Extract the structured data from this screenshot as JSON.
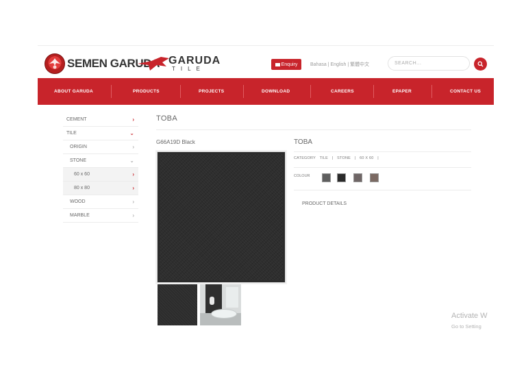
{
  "header": {
    "brand_name": "SEMEN GARUDA",
    "garuda_word": "GARUDA",
    "tile_word": "TILE",
    "enquiry_label": "Enquiry",
    "languages": "Bahasa | English | 繁體中文",
    "search_placeholder": "SEARCH..."
  },
  "nav": {
    "items": [
      "ABOUT GARUDA",
      "PRODUCTS",
      "PROJECTS",
      "DOWNLOAD",
      "CAREERS",
      "EPAPER",
      "CONTACT US"
    ]
  },
  "sidebar": {
    "items": [
      {
        "label": "CEMENT",
        "chevron": "›"
      },
      {
        "label": "TILE",
        "chevron": "⌄"
      },
      {
        "label": "ORIGIN",
        "chevron": "›"
      },
      {
        "label": "STONE",
        "chevron": "⌄"
      },
      {
        "label": "60 x 60",
        "chevron": "›"
      },
      {
        "label": "80 x 80",
        "chevron": "›"
      },
      {
        "label": "WOOD",
        "chevron": "›"
      },
      {
        "label": "MARBLE",
        "chevron": "›"
      }
    ]
  },
  "main": {
    "title": "TOBA",
    "product_code": "G66A19D Black"
  },
  "detail": {
    "name": "TOBA",
    "category_label": "CATEGORY",
    "categories": [
      "TILE",
      "|",
      "STONE",
      "|",
      "60 X 60",
      "|"
    ],
    "colour_label": "COLOUR",
    "colours": [
      "#5e5e5e",
      "#2a2a2a",
      "#6f6666",
      "#7b6a63"
    ],
    "product_details_label": "PRODUCT DETAILS"
  },
  "watermark": {
    "line1": "Activate W",
    "line2": "Go to Setting"
  },
  "colors": {
    "accent": "#c8242b"
  }
}
